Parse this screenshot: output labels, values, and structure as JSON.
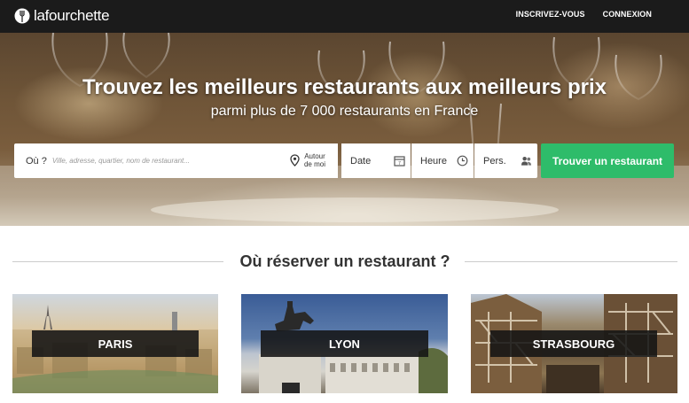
{
  "header": {
    "brand": "lafourchette",
    "nav": [
      "INSCRIVEZ-VOUS",
      "CONNEXION"
    ]
  },
  "hero": {
    "title": "Trouvez les meilleurs restaurants aux meilleurs prix",
    "subtitle": "parmi plus de 7 000 restaurants en France"
  },
  "search": {
    "where_label": "Où ?",
    "where_placeholder": "Ville, adresse, quartier, nom de restaurant...",
    "around_me": "Autour de moi",
    "date_label": "Date",
    "time_label": "Heure",
    "persons_label": "Pers.",
    "submit": "Trouver un restaurant"
  },
  "section": {
    "title": "Où réserver un restaurant ?"
  },
  "cities": [
    "PARIS",
    "LYON",
    "STRASBOURG"
  ],
  "colors": {
    "topbar": "#1b1b1b",
    "accent_green": "#2ebc6a"
  }
}
